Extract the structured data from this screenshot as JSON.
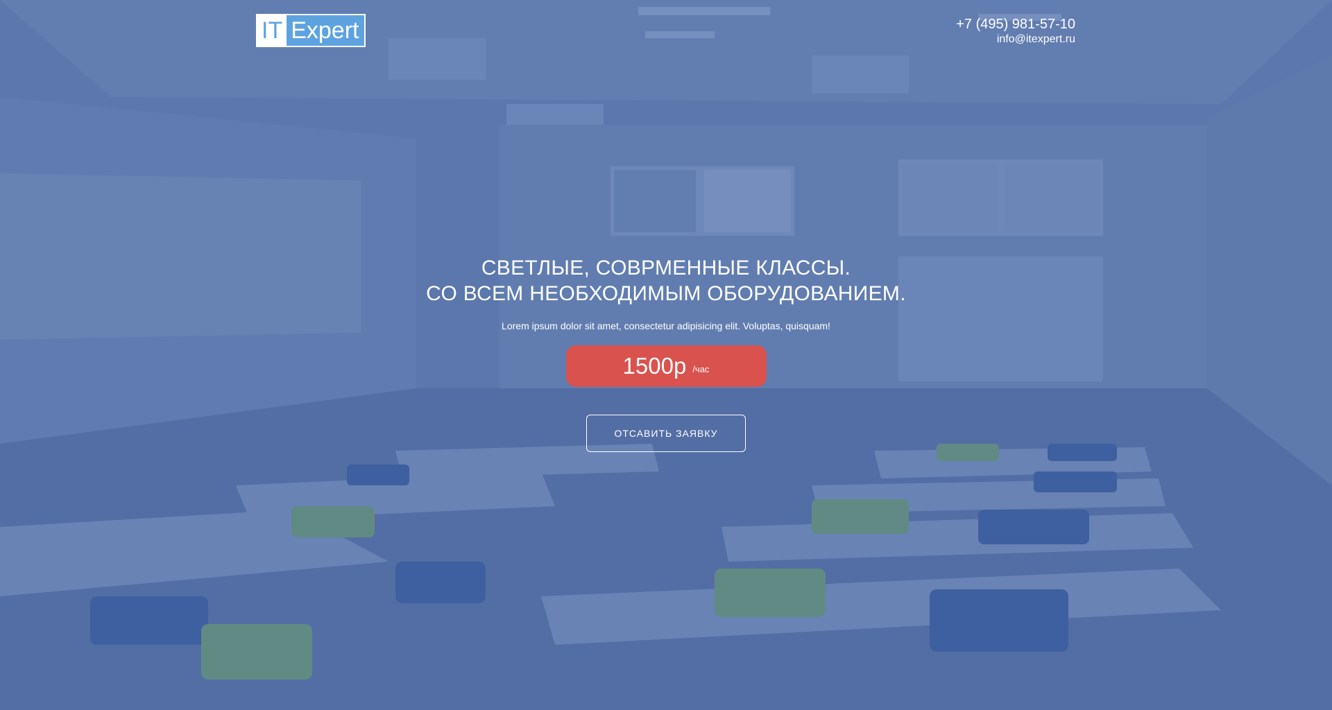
{
  "header": {
    "logo": {
      "part1": "IT",
      "part2": "Expert"
    },
    "phone": "+7 (495) 981-57-10",
    "email": "info@itexpert.ru"
  },
  "hero": {
    "headline_line1": "СВЕТЛЫЕ, СОВРМЕННЫЕ КЛАССЫ.",
    "headline_line2": "СО ВСЕМ НЕОБХОДИМЫМ ОБОРУДОВАНИЕМ.",
    "subtitle": "Lorem ipsum dolor sit amet, consectetur adipisicing elit. Voluptas, quisquam!",
    "price_value": "1500р",
    "price_unit": "/час",
    "cta_label": "ОТСАВИТЬ ЗАЯВКУ"
  },
  "colors": {
    "overlay_blue": "#4b66a0",
    "price_badge": "#d9524e",
    "logo_blue": "#5ea3e0",
    "text": "#ffffff"
  }
}
